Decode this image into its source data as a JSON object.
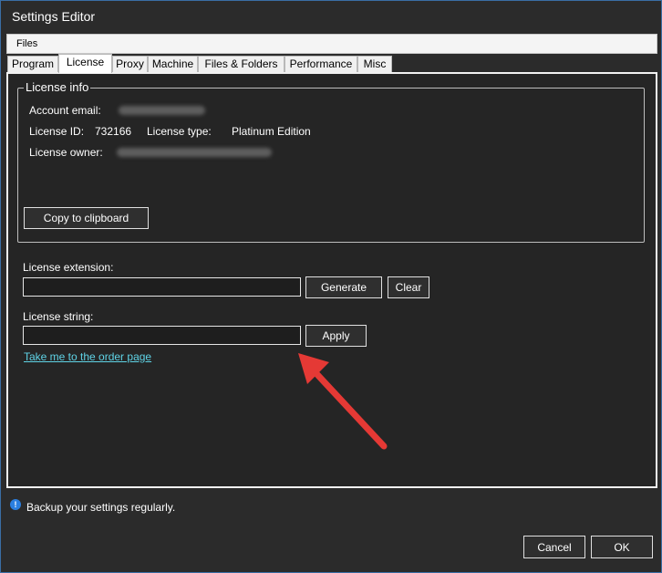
{
  "window": {
    "title": "Settings Editor"
  },
  "menu": {
    "files": "Files"
  },
  "tabs": [
    {
      "label": "Program"
    },
    {
      "label": "License"
    },
    {
      "label": "Proxy"
    },
    {
      "label": "Machine"
    },
    {
      "label": "Files & Folders"
    },
    {
      "label": "Performance"
    },
    {
      "label": "Misc"
    }
  ],
  "license_info": {
    "legend": "License info",
    "account_email_label": "Account email:",
    "license_id_label": "License ID:",
    "license_id_value": "732166",
    "license_type_label": "License type:",
    "license_type_value": "Platinum Edition",
    "license_owner_label": "License owner:",
    "copy_button": "Copy to clipboard"
  },
  "extension": {
    "label": "License extension:",
    "value": "",
    "generate_button": "Generate",
    "clear_button": "Clear"
  },
  "license_string": {
    "label": "License string:",
    "value": "",
    "apply_button": "Apply"
  },
  "order_link": "Take me to the order page",
  "status": {
    "message": "Backup your settings regularly."
  },
  "footer": {
    "cancel": "Cancel",
    "ok": "OK"
  },
  "colors": {
    "background": "#2b2b2b",
    "panel": "#252525",
    "link": "#5fd3e6",
    "annotation_arrow": "#e53935",
    "info_icon": "#2a7fe0"
  }
}
